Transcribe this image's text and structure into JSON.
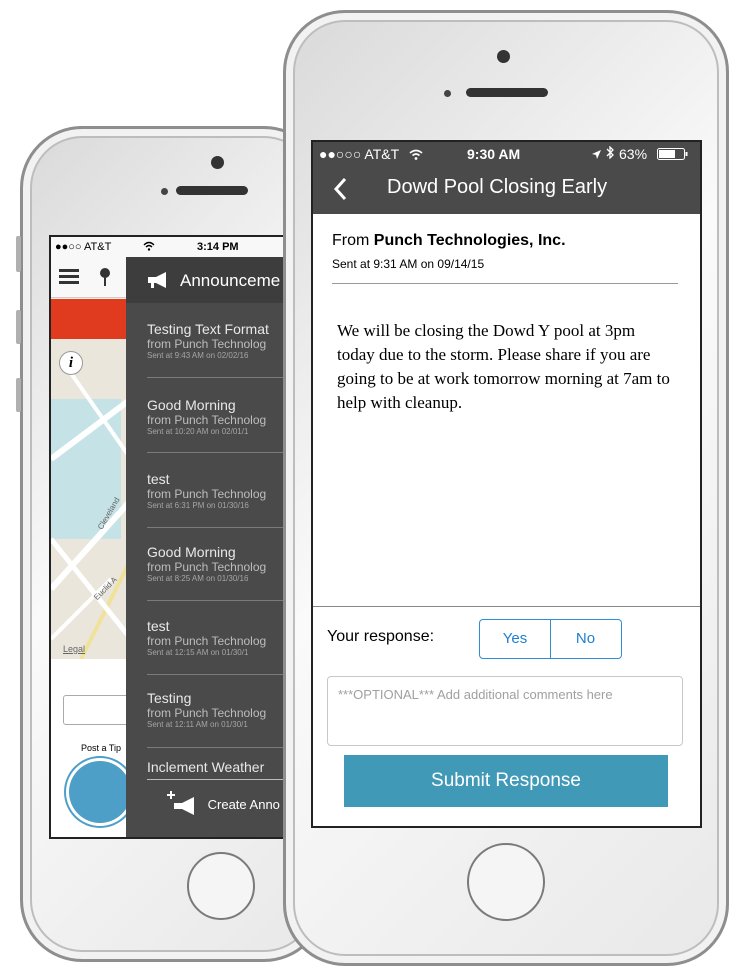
{
  "back_phone": {
    "status": {
      "carrier": "●●○○ AT&T",
      "time": "3:14 PM"
    },
    "map": {
      "streets": [
        "Cleveland",
        "Euclid A"
      ],
      "legal_label": "Legal"
    },
    "post_tip_label": "Post a Tip",
    "drawer": {
      "title": "Announceme",
      "items": [
        {
          "title": "Testing Text Format",
          "from": "from Punch Technolog",
          "sent": "Sent at 9:43 AM on 02/02/16"
        },
        {
          "title": "Good Morning",
          "from": "from Punch Technolog",
          "sent": "Sent at 10:20 AM on 02/01/1"
        },
        {
          "title": "test",
          "from": "from Punch Technolog",
          "sent": "Sent at 6:31 PM on 01/30/16"
        },
        {
          "title": "Good Morning",
          "from": "from Punch Technolog",
          "sent": "Sent at 8:25 AM on 01/30/16"
        },
        {
          "title": "test",
          "from": "from Punch Technolog",
          "sent": "Sent at 12:15 AM on 01/30/1"
        },
        {
          "title": "Testing",
          "from": "from Punch Technolog",
          "sent": "Sent at 12:11 AM on 01/30/1"
        },
        {
          "title": "Inclement Weather",
          "from": "",
          "sent": ""
        }
      ],
      "create_label": "Create Anno"
    }
  },
  "front_phone": {
    "status": {
      "carrier": "●●○○○ AT&T",
      "time": "9:30 AM",
      "battery": "63%"
    },
    "header": {
      "title": "Dowd Pool Closing Early"
    },
    "from_prefix": "From",
    "from_org": "Punch Technologies, Inc.",
    "sent": "Sent at 9:31 AM on 09/14/15",
    "body": "We will be closing the Dowd Y pool at 3pm today due to the storm. Please share if you are going to be at work tomorrow morning at 7am to help with cleanup.",
    "response_label": "Your response:",
    "options": [
      "Yes",
      "No"
    ],
    "comment_placeholder": "***OPTIONAL*** Add additional comments here",
    "submit_label": "Submit Response"
  },
  "colors": {
    "accent_blue": "#1f7fd0",
    "submit": "#4199b8",
    "header_dark": "#4a4a4a",
    "alert_red": "#e03a1f"
  }
}
